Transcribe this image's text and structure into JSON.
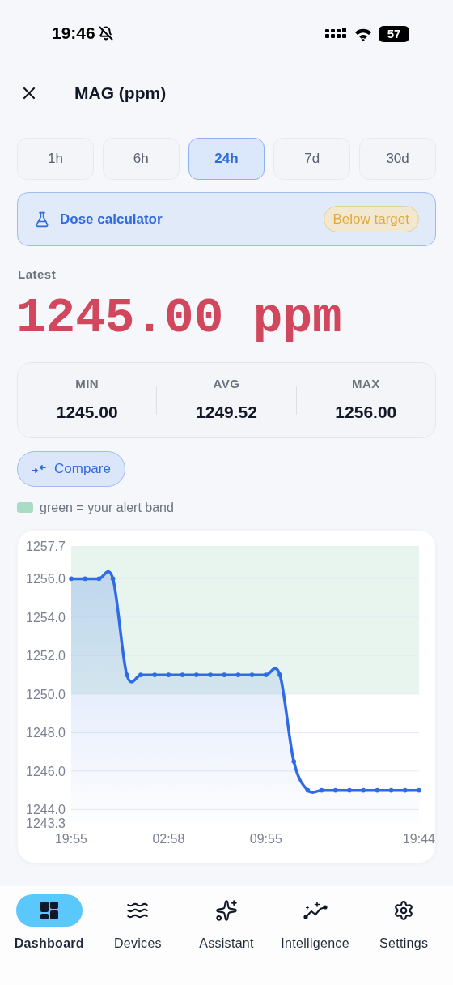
{
  "status_bar": {
    "time": "19:46",
    "battery": "57"
  },
  "header": {
    "title": "MAG (ppm)"
  },
  "ranges": [
    {
      "label": "1h",
      "selected": false
    },
    {
      "label": "6h",
      "selected": false
    },
    {
      "label": "24h",
      "selected": true
    },
    {
      "label": "7d",
      "selected": false
    },
    {
      "label": "30d",
      "selected": false
    }
  ],
  "dose_calculator": {
    "label": "Dose calculator",
    "badge": "Below target"
  },
  "latest": {
    "label": "Latest",
    "value": "1245.00 ppm"
  },
  "stats": [
    {
      "label": "MIN",
      "value": "1245.00"
    },
    {
      "label": "AVG",
      "value": "1249.52"
    },
    {
      "label": "MAX",
      "value": "1256.00"
    }
  ],
  "compare_button": "Compare",
  "legend": {
    "text": "green = your alert band",
    "color": "#a8dcc4"
  },
  "chart": {
    "chart_data": {
      "type": "area",
      "categories": [
        "19:55",
        null,
        null,
        null,
        null,
        null,
        null,
        "02:58",
        null,
        null,
        null,
        null,
        null,
        null,
        "09:55",
        null,
        null,
        null,
        null,
        null,
        null,
        null,
        null,
        null,
        null,
        "19:44"
      ],
      "series": [
        {
          "color": "#2f6be6",
          "values": [
            1256,
            1256,
            1256,
            1256,
            1251,
            1251,
            1251,
            1251,
            1251,
            1251,
            1251,
            1251,
            1251,
            1251,
            1251,
            1251,
            1246.5,
            1245,
            1245,
            1245,
            1245,
            1245,
            1245,
            1245,
            1245,
            1245
          ]
        }
      ],
      "ylim": [
        1243.3,
        1257.7
      ],
      "yticks": [
        {
          "value": 1243.3,
          "label": "1243.3"
        },
        {
          "value": 1244,
          "label": "1244.0"
        },
        {
          "value": 1246,
          "label": "1246.0"
        },
        {
          "value": 1248,
          "label": "1248.0"
        },
        {
          "value": 1250,
          "label": "1250.0"
        },
        {
          "value": 1252,
          "label": "1252.0"
        },
        {
          "value": 1254,
          "label": "1254.0"
        },
        {
          "value": 1256,
          "label": "1256.0"
        },
        {
          "value": 1257.7,
          "label": "1257.7"
        }
      ],
      "grid": true,
      "bands": [
        {
          "axis": "y",
          "from": 1250,
          "to": 1257.7,
          "color": "#e8f5ef"
        }
      ]
    }
  },
  "nav": [
    {
      "label": "Dashboard",
      "selected": true
    },
    {
      "label": "Devices",
      "selected": false
    },
    {
      "label": "Assistant",
      "selected": false
    },
    {
      "label": "Intelligence",
      "selected": false
    },
    {
      "label": "Settings",
      "selected": false
    }
  ]
}
